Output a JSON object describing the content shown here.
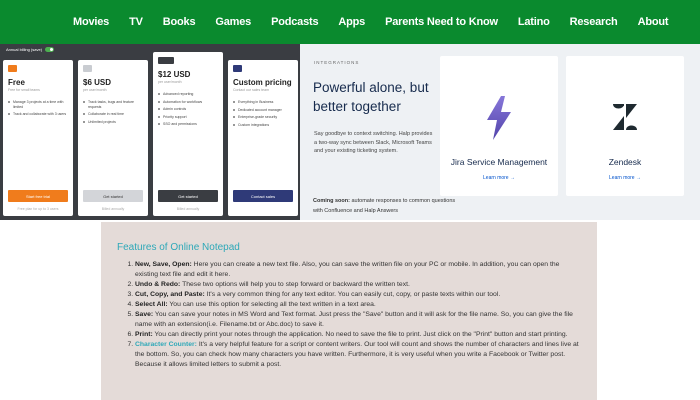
{
  "nav": {
    "items": [
      "Movies",
      "TV",
      "Books",
      "Games",
      "Podcasts",
      "Apps",
      "Parents Need to Know",
      "Latino",
      "Research",
      "About"
    ]
  },
  "pricing": {
    "billing_label": "Annual billing (save)",
    "plans": [
      {
        "name": "Free",
        "sub": "Free for small teams",
        "features": [
          "Manage 3 projects at a time with limited",
          "Track and collaborate with 3 users"
        ],
        "cta": "Start free trial",
        "foot": "Free plan for up to 3 users"
      },
      {
        "name": "$6 USD",
        "sub": "per user/month",
        "features": [
          "Track tasks, bugs and feature requests",
          "Collaborate in real time",
          "Unlimited projects"
        ],
        "cta": "Get started",
        "foot": "Billed annually"
      },
      {
        "name": "$12 USD",
        "sub": "per user/month",
        "badge": "Business",
        "features": [
          "Advanced reporting",
          "Automation for workflows",
          "Admin controls",
          "Priority support",
          "SSO and permissions"
        ],
        "cta": "Get started",
        "foot": "Billed annually"
      },
      {
        "name": "Custom pricing",
        "sub": "Contact our sales team",
        "features": [
          "Everything in Business",
          "Dedicated account manager",
          "Enterprise-grade security",
          "Custom integrations"
        ],
        "cta": "Contact sales",
        "foot": ""
      }
    ]
  },
  "integrations": {
    "eyebrow": "INTEGRATIONS",
    "headline": "Powerful alone, but better together",
    "paragraph": "Say goodbye to context switching. Halp provides a two-way sync between Slack, Microsoft Teams and your existing ticketing system.",
    "tiles": [
      {
        "name": "Jira Service Management",
        "link": "Learn more →"
      },
      {
        "name": "Zendesk",
        "link": "Learn more →"
      }
    ],
    "coming_soon_label": "Coming soon:",
    "coming_soon_text": " automate responses to common questions with Confluence and Halp Answers"
  },
  "notepad": {
    "title": "Features of Online Notepad",
    "items": [
      {
        "label": "New, Save, Open:",
        "text": " Here you can create a new text file. Also, you can save the written file on your PC or mobile. In addition, you can open the existing text file and edit it here."
      },
      {
        "label": "Undo & Redo:",
        "text": " These two options will help you to step forward or backward the written text."
      },
      {
        "label": "Cut, Copy, and Paste:",
        "text": " It's a very common thing for any text editor. You can easily cut, copy, or paste texts within our tool."
      },
      {
        "label": "Select All:",
        "text": " You can use this option for selecting all the text written in a text area."
      },
      {
        "label": "Save:",
        "text": " You can save your notes in MS Word and Text format. Just press the \"Save\" button and it will ask for the file name. So, you can give the file name with an extension(i.e. Filename.txt or Abc.doc) to save it."
      },
      {
        "label": "Print:",
        "text": " You can directly print your notes through the application. No need to save the file to print. Just click on the \"Print\" button and start printing."
      },
      {
        "label": "Character Counter:",
        "text": " It's a very helpful feature for a script or content writers. Our tool will count and shows the number of characters and lines live at the bottom. So, you can check how many characters you have written. Furthermore, it is very useful when you write a Facebook or Twitter post. Because it allows limited letters to submit a post."
      }
    ]
  },
  "colors": {
    "nav_bg": "#0a8a2e",
    "accent_orange": "#f07c1c",
    "accent_teal": "#2ea8b8",
    "jira_blue": "#0052cc"
  }
}
